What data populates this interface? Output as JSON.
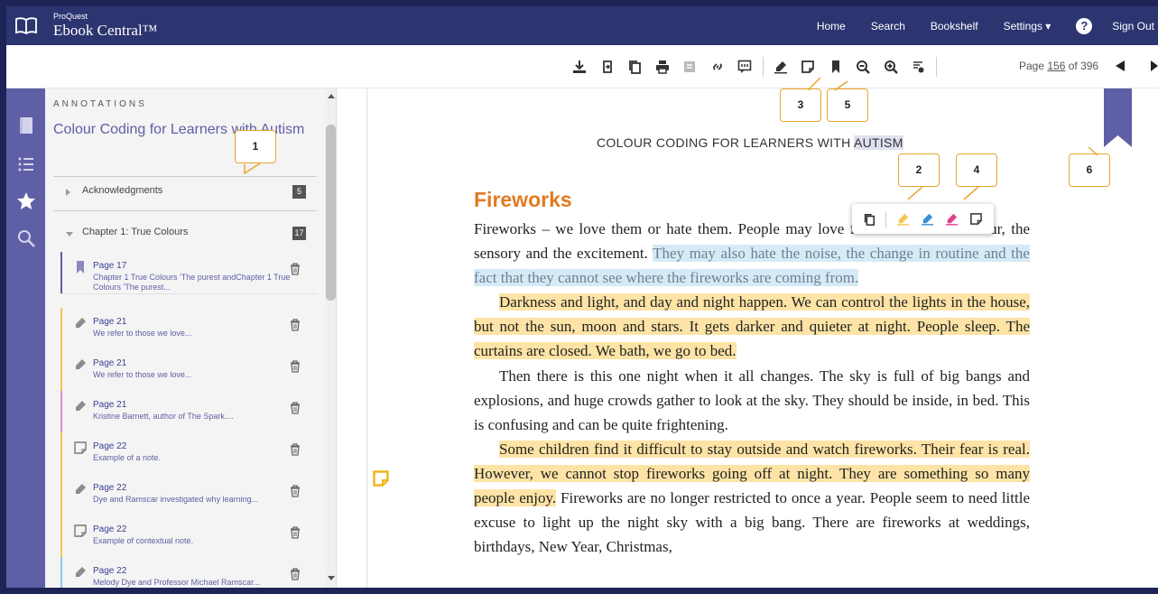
{
  "header": {
    "brand_small": "ProQuest",
    "brand_big": "Ebook Central™",
    "nav": [
      "Home",
      "Search",
      "Bookshelf",
      "Settings ▾",
      "Sign Out"
    ],
    "help": "?"
  },
  "toolbar": {
    "page_prefix": "Page ",
    "page_number": "156",
    "page_suffix": " of 396"
  },
  "panel": {
    "label": "ANNOTATIONS",
    "book_title": "Colour Coding for Learners with Autism",
    "sections": [
      {
        "name": "Acknowledgments",
        "count": "5"
      },
      {
        "name": "Chapter 1: True Colours",
        "count": "17"
      }
    ],
    "items": [
      {
        "type": "bookmark",
        "page": "Page 17",
        "snippet": "Chapter 1 True Colours 'The purest andChapter 1 True Colours 'The purest...",
        "color": "#5e5fa5"
      },
      {
        "type": "highlight",
        "page": "Page 21",
        "snippet": "We refer to those we love...",
        "color": "#f6c652"
      },
      {
        "type": "highlight",
        "page": "Page 21",
        "snippet": "We refer to those we love...",
        "color": "#f6c652"
      },
      {
        "type": "highlight",
        "page": "Page 21",
        "snippet": "Kristine Barnett, author of The Spark....",
        "color": "#e58ad0"
      },
      {
        "type": "note",
        "page": "Page 22",
        "snippet": "Example of a note.",
        "color": "#f6c652"
      },
      {
        "type": "highlight",
        "page": "Page 22",
        "snippet": "Dye and Ramscar investigated why learning...",
        "color": "#f6c652"
      },
      {
        "type": "note",
        "page": "Page 22",
        "snippet": "Example of contextual note.",
        "color": "#f6c652"
      },
      {
        "type": "highlight",
        "page": "Page 22",
        "snippet": "Melody Dye and Professor Michael Ramscar...",
        "color": "#8cc6ea"
      }
    ]
  },
  "reader": {
    "running_head_prefix": "COLOUR CODING FOR LEARNERS WITH ",
    "running_head_highlight": "AUTISM",
    "heading": "Fireworks",
    "p1_a": "Fireworks – we love them or hate them. People may love fireworks for the colour, the sensory and the excitement. ",
    "p1_b": "They may also hate the noise, the change in routine and the fact that they cannot see where the fireworks are coming from.",
    "p2": "Darkness and light, and day and night happen. We can control the lights in the house, but not the sun, moon and stars. It gets darker and quieter at night. People sleep. The curtains are closed. We bath, we go to bed.",
    "p3": "Then there is this one night when it all changes. The sky is full of big bangs and explosions, and huge crowds gather to look at the sky. They should be inside, in bed. This is confusing and can be quite frightening.",
    "p4_a": "Some children find it difficult to stay outside and watch fireworks. Their fear is real. However, we cannot stop fireworks going off at night. They are something so many people enjoy.",
    "p4_b": " Fireworks are no longer restricted to once a year. People seem to need little excuse to light up the night sky with a big bang. There are fireworks at weddings, birthdays, New Year, Christmas,"
  },
  "callouts": [
    "1",
    "2",
    "3",
    "4",
    "5",
    "6"
  ],
  "colors": {
    "header_bg": "#2c3570",
    "rail_bg": "#5e5fa5",
    "accent": "#e07b22",
    "highlight_yellow": "#fde3a5",
    "highlight_blue": "#d6eaf6",
    "callout_border": "#e9a52d"
  }
}
